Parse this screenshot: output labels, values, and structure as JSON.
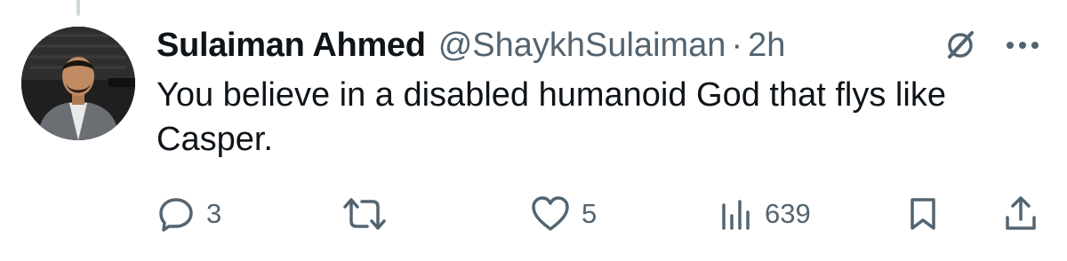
{
  "tweet": {
    "author_name": "Sulaiman Ahmed",
    "handle": "@ShaykhSulaiman",
    "separator": "·",
    "time": "2h",
    "text": "You believe in a disabled humanoid God that flys like Casper."
  },
  "actions": {
    "replies": "3",
    "retweets": "",
    "likes": "5",
    "views": "639"
  },
  "icons": {
    "header": [
      "grok-icon",
      "more-icon"
    ],
    "actions": [
      "reply-icon",
      "retweet-icon",
      "like-icon",
      "views-icon",
      "bookmark-icon",
      "share-icon"
    ]
  },
  "colors": {
    "text": "#0f1419",
    "secondary": "#536471",
    "background": "#ffffff"
  }
}
